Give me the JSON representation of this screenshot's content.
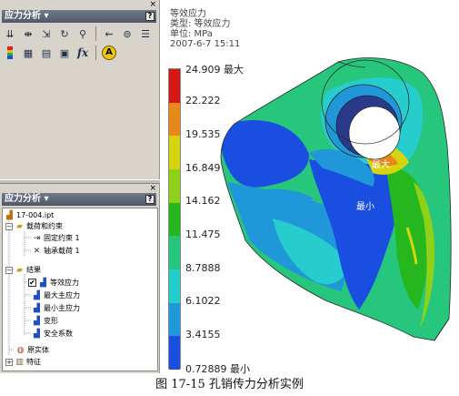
{
  "top_panel": {
    "title": "应力分析 ▾",
    "help": "?",
    "close": "×"
  },
  "bottom_panel": {
    "title": "应力分析 ▾",
    "help": "?",
    "close": "×"
  },
  "toolbar_icons": [
    "load-icon",
    "constraint-icon",
    "moment-icon",
    "rotate-icon",
    "pin-icon",
    "mesh-icon",
    "pressure-icon",
    "settings-icon"
  ],
  "toolbar_row2_icons": [
    "color-bar-icon",
    "table-icon",
    "report-icon",
    "parameter-icon",
    "function-icon",
    "auto-icon"
  ],
  "toolbar_labels": {
    "fx": "fx",
    "auto": "A"
  },
  "tree": {
    "root": "17-004.ipt",
    "loads_group": "载荷和约束",
    "fixed_constraint": "固定约束 1",
    "bearing_load": "轴承载荷 1",
    "results_group": "结果",
    "equivalent_stress": "等效应力",
    "max_principal": "最大主应力",
    "min_principal": "最小主应力",
    "deformation": "变形",
    "safety_factor": "安全系数",
    "solids": "原实体",
    "features": "特征"
  },
  "info": {
    "line1": "等效应力",
    "line2": "类型: 等效应力",
    "line3": "单位: MPa",
    "line4": "2007-6-7 15:11"
  },
  "legend": {
    "labels": [
      "24.909 最大",
      "22.222",
      "19.535",
      "16.849",
      "14.162",
      "11.475",
      "8.7888",
      "6.1022",
      "3.4155",
      "0.72889 最小"
    ],
    "colors": [
      "#d71616",
      "#e88a1a",
      "#d6d40e",
      "#8ed01a",
      "#26b61e",
      "#27c67d",
      "#27cccc",
      "#1f97d9",
      "#1a4ee0"
    ]
  },
  "model_labels": {
    "max": "最大",
    "min": "最小"
  },
  "caption": "图 17-15  孔销传力分析实例"
}
